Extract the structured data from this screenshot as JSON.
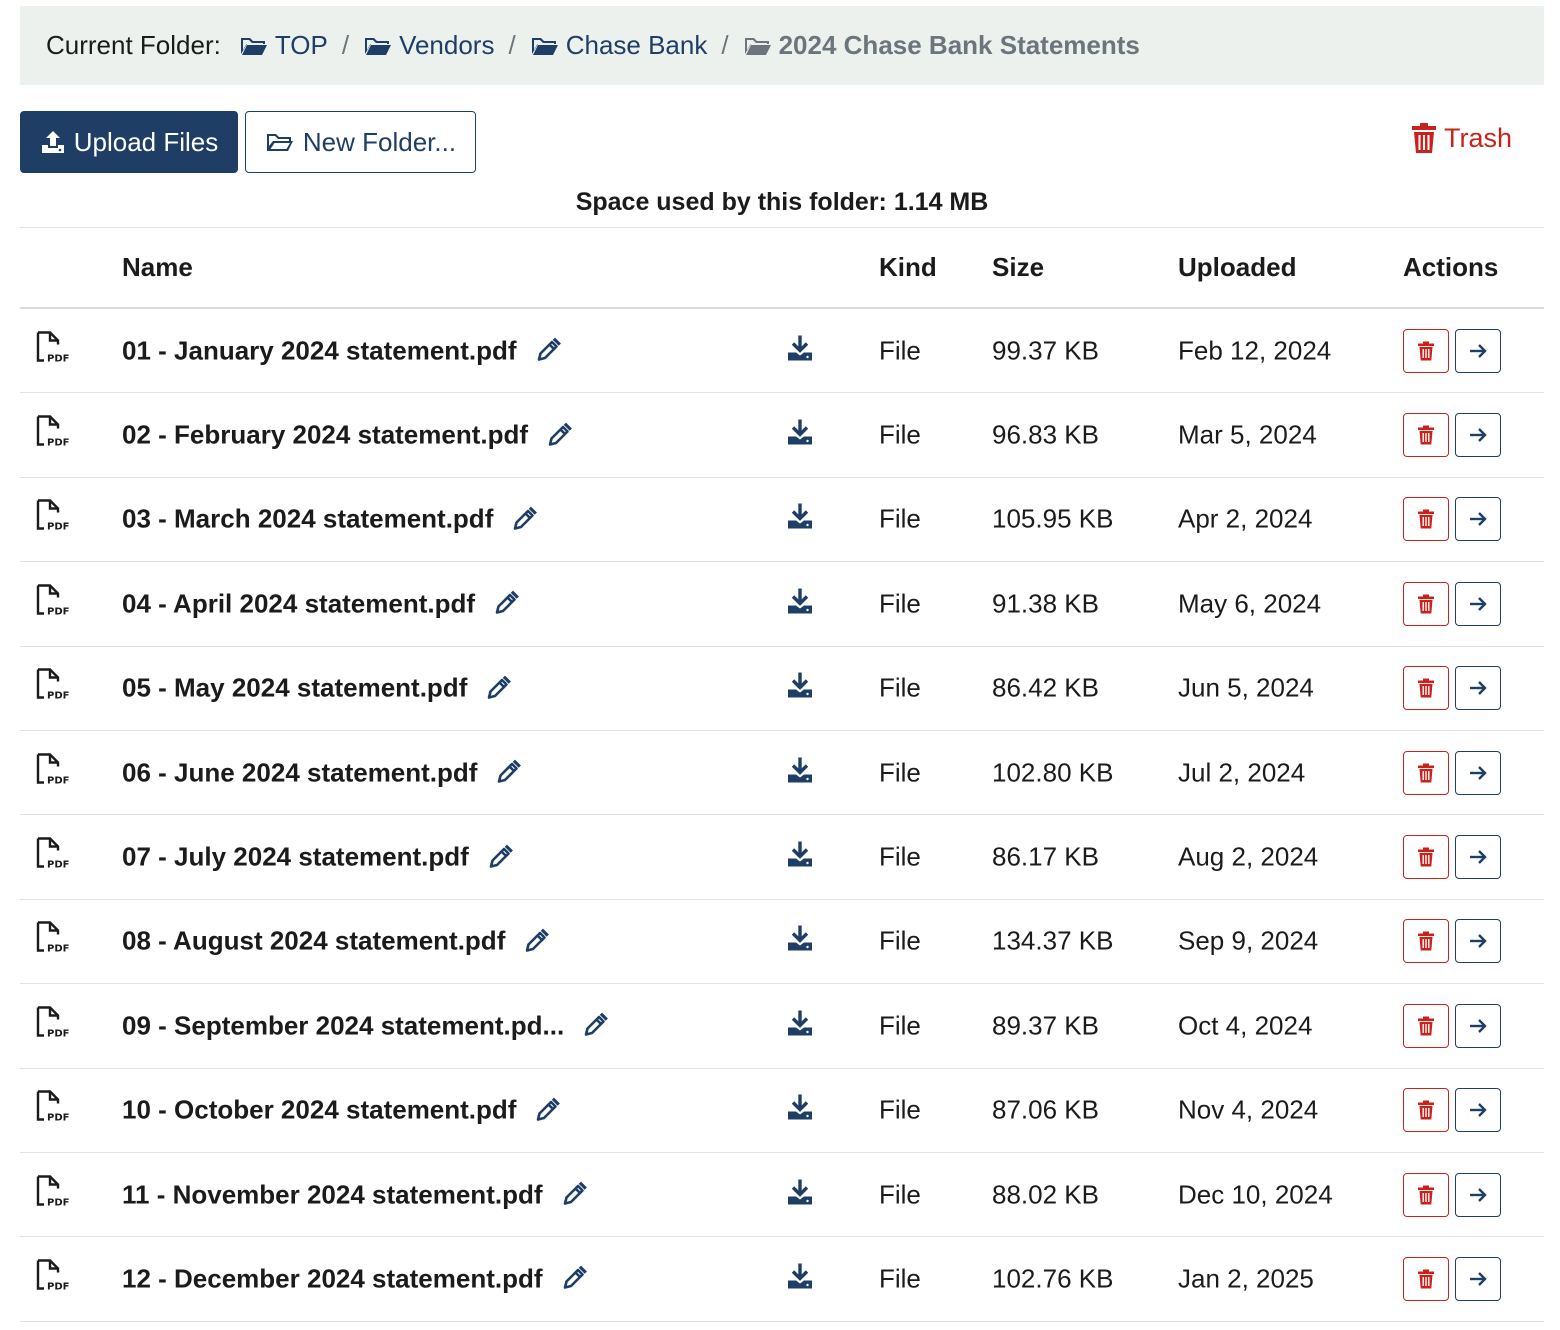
{
  "breadcrumb": {
    "label": "Current Folder:",
    "items": [
      {
        "label": "TOP",
        "icon": "folder-open-icon"
      },
      {
        "label": "Vendors",
        "icon": "folder-open-icon"
      },
      {
        "label": "Chase Bank",
        "icon": "folder-open-icon"
      }
    ],
    "current": {
      "label": "2024 Chase Bank Statements",
      "icon": "folder-open-icon"
    },
    "separator": "/"
  },
  "toolbar": {
    "upload_label": "Upload Files",
    "new_folder_label": "New Folder...",
    "trash_label": "Trash"
  },
  "space_used": "Space used by this folder: 1.14 MB",
  "table": {
    "headers": {
      "name": "Name",
      "kind": "Kind",
      "size": "Size",
      "uploaded": "Uploaded",
      "actions": "Actions"
    },
    "rows": [
      {
        "name": "01 - January 2024 statement.pdf",
        "kind": "File",
        "size": "99.37 KB",
        "uploaded": "Feb 12, 2024"
      },
      {
        "name": "02 - February 2024 statement.pdf",
        "kind": "File",
        "size": "96.83 KB",
        "uploaded": "Mar 5, 2024"
      },
      {
        "name": "03 - March 2024 statement.pdf",
        "kind": "File",
        "size": "105.95 KB",
        "uploaded": "Apr 2, 2024"
      },
      {
        "name": "04 - April 2024 statement.pdf",
        "kind": "File",
        "size": "91.38 KB",
        "uploaded": "May 6, 2024"
      },
      {
        "name": "05 - May 2024 statement.pdf",
        "kind": "File",
        "size": "86.42 KB",
        "uploaded": "Jun 5, 2024"
      },
      {
        "name": "06 - June 2024 statement.pdf",
        "kind": "File",
        "size": "102.80 KB",
        "uploaded": "Jul 2, 2024"
      },
      {
        "name": "07 - July 2024 statement.pdf",
        "kind": "File",
        "size": "86.17 KB",
        "uploaded": "Aug 2, 2024"
      },
      {
        "name": "08 - August 2024 statement.pdf",
        "kind": "File",
        "size": "134.37 KB",
        "uploaded": "Sep 9, 2024"
      },
      {
        "name": "09 - September 2024 statement.pd...",
        "kind": "File",
        "size": "89.37 KB",
        "uploaded": "Oct 4, 2024"
      },
      {
        "name": "10 - October 2024 statement.pdf",
        "kind": "File",
        "size": "87.06 KB",
        "uploaded": "Nov 4, 2024"
      },
      {
        "name": "11 - November 2024 statement.pdf",
        "kind": "File",
        "size": "88.02 KB",
        "uploaded": "Dec 10, 2024"
      },
      {
        "name": "12 - December 2024 statement.pdf",
        "kind": "File",
        "size": "102.76 KB",
        "uploaded": "Jan 2, 2025"
      }
    ]
  },
  "icons": {
    "file": "file-pdf-icon",
    "rename": "pencil-icon",
    "download": "download-icon",
    "delete": "trash-icon",
    "move": "arrow-right-icon"
  },
  "colors": {
    "primary": "#1f3e66",
    "danger": "#c8221c",
    "breadcrumb_bg": "#ecf1ee",
    "muted": "#6c757d"
  }
}
